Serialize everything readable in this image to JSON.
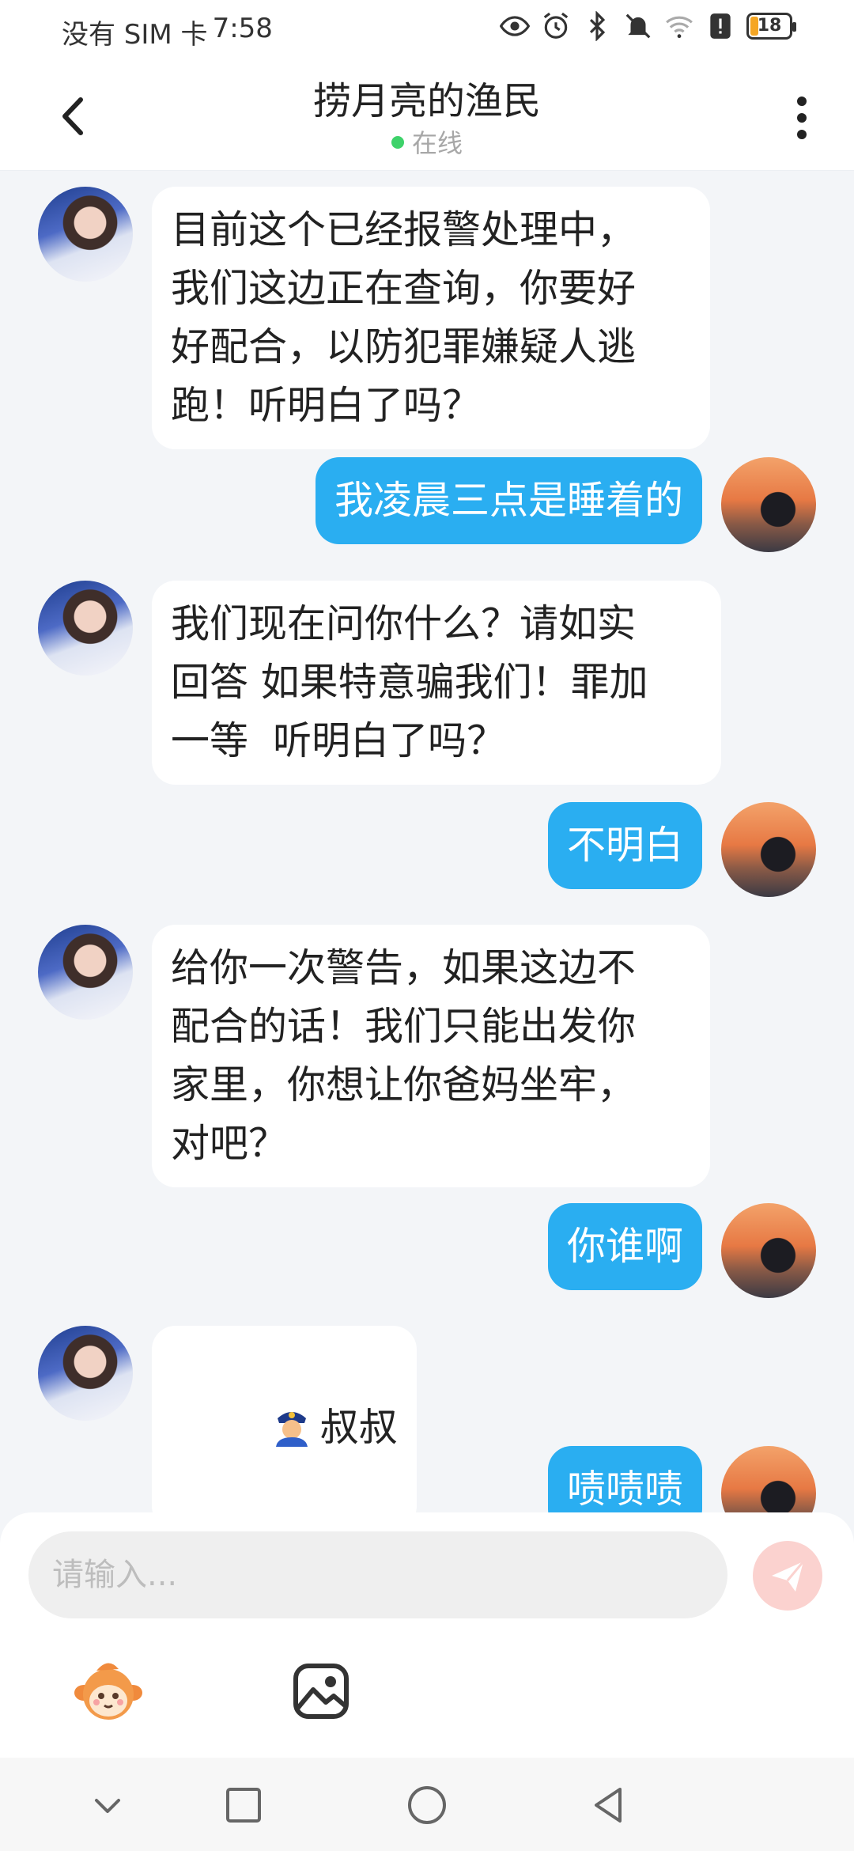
{
  "status_bar": {
    "carrier": "没有 SIM 卡",
    "time": "7:58",
    "battery": "18",
    "icons": [
      "eye-icon",
      "alarm-icon",
      "bluetooth-icon",
      "mute-icon",
      "wifi-icon",
      "alert-icon",
      "battery-icon"
    ]
  },
  "header": {
    "title": "捞月亮的渔民",
    "status": "在线",
    "status_color": "#3ed26a"
  },
  "messages": [
    {
      "side": "in",
      "text": "目前这个已经报警处理中，\n我们这边正在查询，你要好\n好配合，以防犯罪嫌疑人逃\n跑！听明白了吗？"
    },
    {
      "side": "out",
      "text": "我凌晨三点是睡着的"
    },
    {
      "side": "in",
      "text": "我们现在问你什么？请如实\n回答 如果特意骗我们！罪加\n一等  听明白了吗？"
    },
    {
      "side": "out",
      "text": "不明白"
    },
    {
      "side": "in",
      "text": "给你一次警告，如果这边不\n配合的话！我们只能出发你\n家里，你想让你爸妈坐牢，\n对吧？"
    },
    {
      "side": "out",
      "text": "你谁啊"
    },
    {
      "side": "in",
      "text": "叔叔",
      "emoji": "police-officer-icon"
    },
    {
      "side": "out",
      "text": "啧啧啧"
    }
  ],
  "composer": {
    "placeholder": "请输入...",
    "value": ""
  },
  "colors": {
    "outgoing_bubble": "#2aaef1",
    "incoming_bubble": "#ffffff",
    "background": "#f3f5f8",
    "send_button": "#fbd2cf"
  }
}
